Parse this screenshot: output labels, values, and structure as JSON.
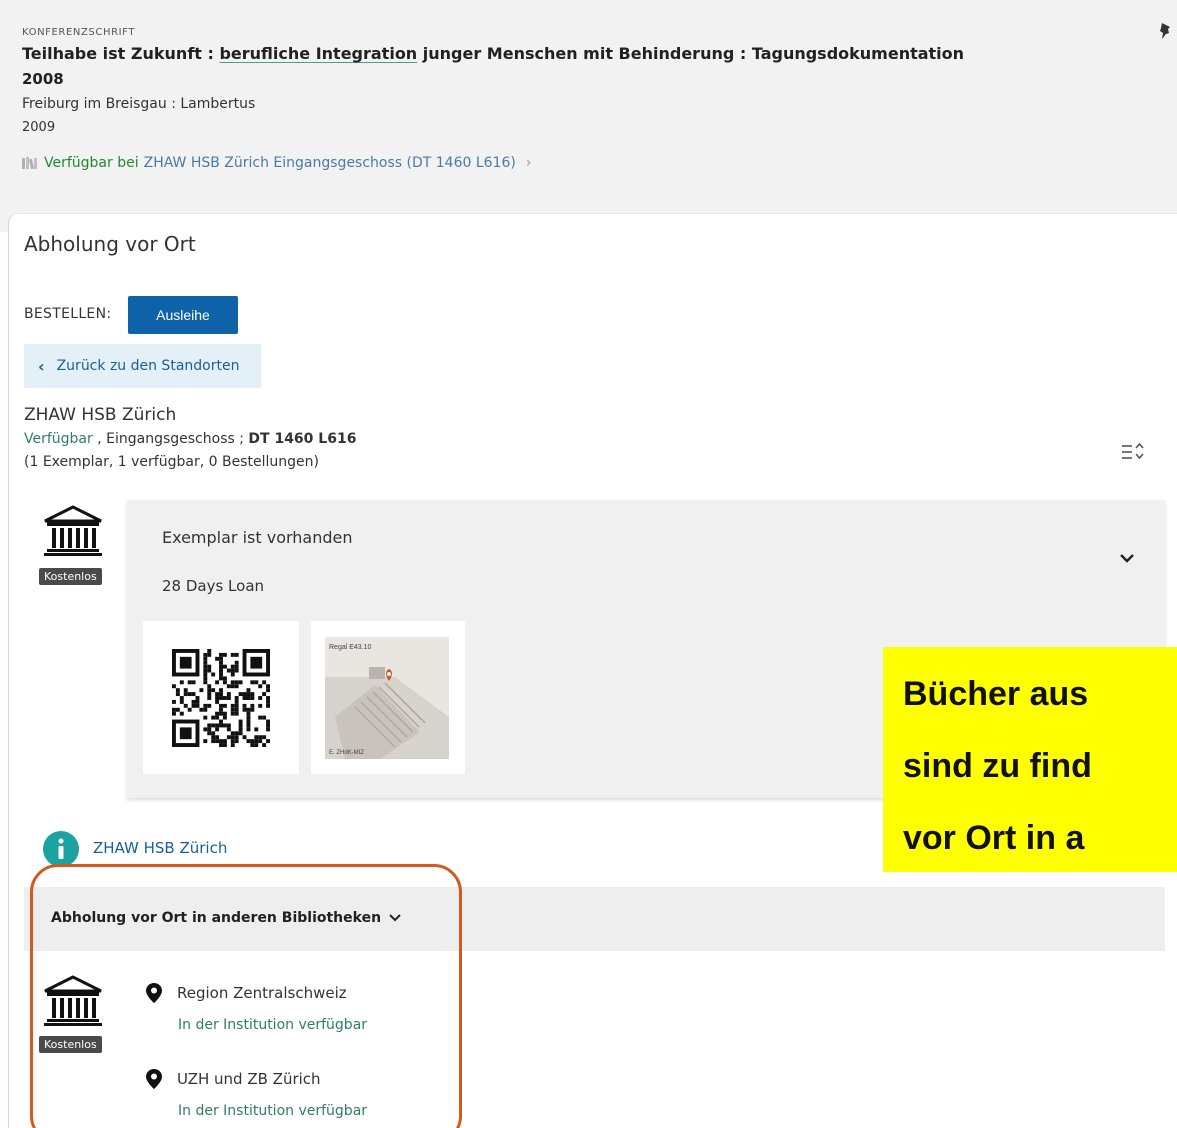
{
  "record": {
    "type_label": "KONFERENZSCHRIFT",
    "title_prefix": "Teilhabe ist Zukunft : ",
    "title_link": "berufliche Integration",
    "title_suffix": " junger Menschen mit Behinderung : Tagungsdokumentation",
    "title_year": "2008",
    "publisher": "Freiburg im Breisgau : Lambertus",
    "pub_year": "2009",
    "availability_status": "Verfügbar bei",
    "availability_location": "ZHAW HSB Zürich  Eingangsgeschoss (DT 1460 L616)",
    "availability_chevron": "›"
  },
  "panel": {
    "title": "Abholung vor Ort",
    "order_label": "BESTELLEN:",
    "loan_button": "Ausleihe",
    "back_button": "Zurück zu den Standorten",
    "back_arrow": "‹"
  },
  "location": {
    "name": "ZHAW HSB Zürich",
    "status": "Verfügbar",
    "floor": " , Eingangsgeschoss ; ",
    "call_number": "DT 1460 L616",
    "counts": "(1 Exemplar, 1 verfügbar, 0 Bestellungen)"
  },
  "item": {
    "badge": "Kostenlos",
    "status": "Exemplar ist vorhanden",
    "policy": "28 Days Loan",
    "map_label_top": "Regal E43.10",
    "map_label_bottom": "E. ZHdK-MIZ"
  },
  "info_link": "ZHAW HSB Zürich",
  "callout": {
    "line1": "Bücher aus",
    "line2": "sind zu find",
    "line3": "vor Ort in a"
  },
  "other_libraries": {
    "label": "Abholung vor Ort in anderen Bibliotheken",
    "badge": "Kostenlos",
    "branches": [
      {
        "name": "Region Zentralschweiz",
        "status": "In der Institution verfügbar"
      },
      {
        "name": "UZH und ZB Zürich",
        "status": "In der Institution verfügbar"
      }
    ]
  },
  "colors": {
    "accent_blue": "#0e62a8",
    "available_green": "#2e7d6b",
    "highlight_orange": "#d35a1e",
    "callout_yellow": "#ffff00",
    "info_teal": "#1aa3a0"
  }
}
